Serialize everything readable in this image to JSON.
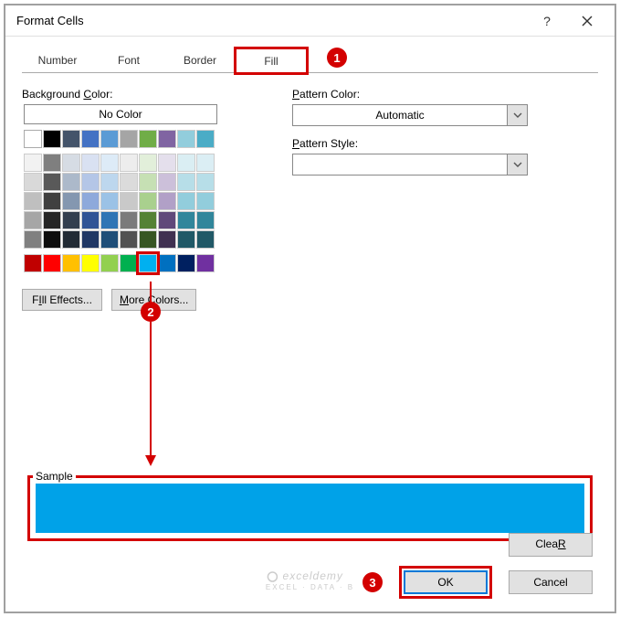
{
  "title": "Format Cells",
  "tabs": {
    "number": "Number",
    "font": "Font",
    "border": "Border",
    "fill": "Fill"
  },
  "active_tab": "fill",
  "left": {
    "bg_label_pre": "Background ",
    "bg_label_u": "C",
    "bg_label_post": "olor:",
    "no_color": "No Color",
    "fill_effects_u": "I",
    "fill_effects_post": "ll Effects...",
    "fill_effects_pre": "F",
    "more_colors_u": "M",
    "more_colors_post": "ore Colors..."
  },
  "right": {
    "pattern_color_u": "P",
    "pattern_color_post": "attern Color:",
    "automatic": "Automatic",
    "pattern_style_pre_u": "P",
    "pattern_style_post": "attern Style:"
  },
  "sample_label": "Sample",
  "sample_color": "#00a2e8",
  "clear_u": "R",
  "clear_pre": "Clea",
  "ok": "OK",
  "cancel": "Cancel",
  "callouts": {
    "c1": "1",
    "c2": "2",
    "c3": "3"
  },
  "watermark": {
    "main": "exceldemy",
    "sub": "EXCEL · DATA · B"
  },
  "theme_colors_row1": [
    "#ffffff",
    "#000000",
    "#44546a",
    "#4472c4",
    "#5b9bd5",
    "#a5a5a5",
    "#70ad47",
    "#8064a2",
    "#92cddc",
    "#4bacc6"
  ],
  "theme_tints": [
    [
      "#f2f2f2",
      "#7f7f7f",
      "#d6dce4",
      "#d9e1f2",
      "#ddebf7",
      "#ededed",
      "#e2efda",
      "#e4dfec",
      "#daeef3",
      "#dbeef4"
    ],
    [
      "#d9d9d9",
      "#595959",
      "#acb9ca",
      "#b4c6e7",
      "#bdd7ee",
      "#dbdbdb",
      "#c6e0b4",
      "#ccc0da",
      "#b7dee8",
      "#b7dee8"
    ],
    [
      "#bfbfbf",
      "#404040",
      "#8497b0",
      "#8ea9db",
      "#9bc2e6",
      "#c9c9c9",
      "#a9d08e",
      "#b1a0c7",
      "#92cddc",
      "#92cddc"
    ],
    [
      "#a6a6a6",
      "#262626",
      "#333f4f",
      "#305496",
      "#2f75b5",
      "#7b7b7b",
      "#548235",
      "#60497a",
      "#31869b",
      "#31869b"
    ],
    [
      "#808080",
      "#0d0d0d",
      "#222b35",
      "#203764",
      "#1f4e78",
      "#525252",
      "#375623",
      "#403151",
      "#215967",
      "#215967"
    ]
  ],
  "standard_colors": [
    "#c00000",
    "#ff0000",
    "#ffc000",
    "#ffff00",
    "#92d050",
    "#00b050",
    "#00b0f0",
    "#0070c0",
    "#002060",
    "#7030a0"
  ],
  "selected_standard_index": 6
}
